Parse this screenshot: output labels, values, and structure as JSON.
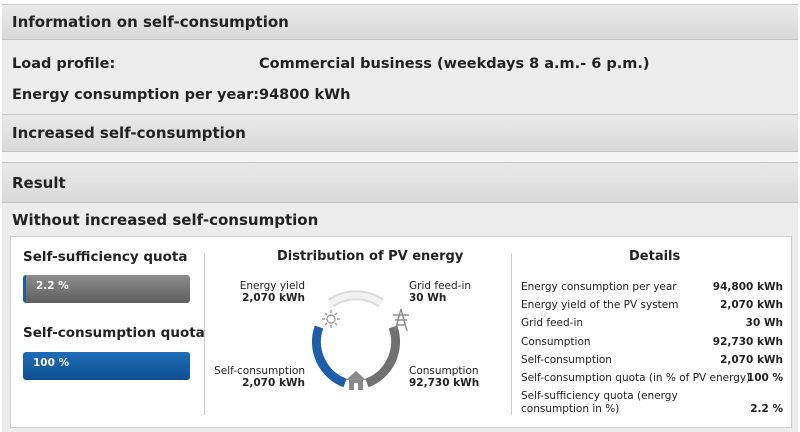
{
  "info_section": {
    "title": "Information on self-consumption",
    "load_profile_label": "Load profile:",
    "load_profile_value": "Commercial business (weekdays 8 a.m.- 6 p.m.)",
    "energy_label": "Energy consumption per year:",
    "energy_value": "94800 kWh"
  },
  "increased_section": {
    "title": "Increased self-consumption"
  },
  "result_section": {
    "title": "Result",
    "subheading": "Without increased self-consumption"
  },
  "quotas": {
    "self_sufficiency": {
      "title": "Self-sufficiency quota",
      "value_text": "2.2 %",
      "fraction": 0.022
    },
    "self_consumption": {
      "title": "Self-consumption quota",
      "value_text": "100 %",
      "fraction": 1.0
    }
  },
  "distribution": {
    "title": "Distribution of PV energy",
    "energy_yield": {
      "label": "Energy yield",
      "value": "2,070 kWh"
    },
    "grid_feed_in": {
      "label": "Grid feed-in",
      "value": "30 Wh"
    },
    "self_consumption": {
      "label": "Self-consumption",
      "value": "2,070 kWh"
    },
    "consumption": {
      "label": "Consumption",
      "value": "92,730 kWh"
    },
    "icons": [
      "sun-icon",
      "power-pylon-icon",
      "house-icon"
    ],
    "colors": {
      "blue": "#1d5ea8",
      "grey": "#6e6e6e",
      "light": "#e0e0e0"
    }
  },
  "details": {
    "title": "Details",
    "rows": [
      {
        "label": "Energy consumption per year",
        "value": "94,800 kWh"
      },
      {
        "label": "Energy yield of the PV system",
        "value": "2,070 kWh"
      },
      {
        "label": "Grid feed-in",
        "value": "30 Wh"
      },
      {
        "label": "Consumption",
        "value": "92,730 kWh"
      },
      {
        "label": "Self-consumption",
        "value": "2,070 kWh"
      },
      {
        "label": "Self-consumption quota (in % of PV energy)",
        "value": "100 %"
      },
      {
        "label": "Self-sufficiency quota (energy consumption in %)",
        "value": "2.2 %"
      }
    ]
  }
}
